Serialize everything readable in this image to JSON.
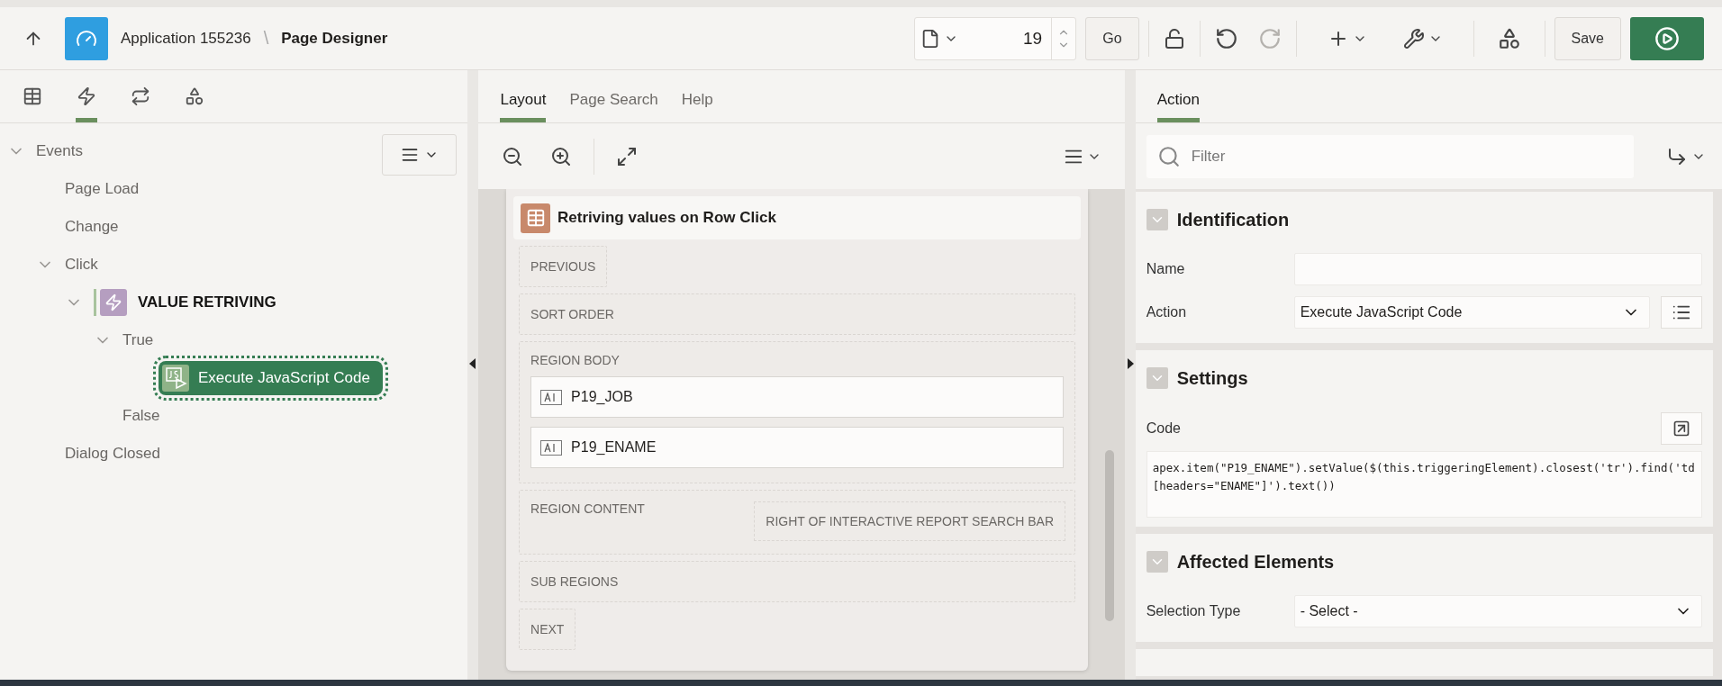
{
  "header": {
    "app": "Application 155236",
    "separator": "\\",
    "page": "Page Designer"
  },
  "toolbar": {
    "page_number": "19",
    "go_label": "Go",
    "save_label": "Save",
    "undo": {
      "disabled": false
    },
    "redo": {
      "disabled": true
    }
  },
  "left_tabs": [
    {
      "kind": "rendering",
      "selected": false
    },
    {
      "kind": "dynamic-actions",
      "selected": true
    },
    {
      "kind": "processing",
      "selected": false
    },
    {
      "kind": "shared",
      "selected": false
    }
  ],
  "tree": [
    {
      "label": "Events",
      "kind": "plain",
      "expanded": true,
      "selected": false,
      "children": [
        {
          "label": "Page Load",
          "kind": "plain",
          "selected": false
        },
        {
          "label": "Change",
          "kind": "plain",
          "selected": false
        },
        {
          "label": "Click",
          "kind": "plain",
          "expanded": true,
          "selected": false,
          "children": [
            {
              "label": "VALUE RETRIVING",
              "kind": "dynamic-action",
              "expanded": true,
              "selected": false,
              "children": [
                {
                  "label": "True",
                  "kind": "plain",
                  "expanded": true,
                  "selected": false,
                  "children": [
                    {
                      "label": "Execute JavaScript Code",
                      "kind": "action",
                      "selected": true
                    }
                  ]
                },
                {
                  "label": "False",
                  "kind": "plain",
                  "selected": false
                }
              ]
            }
          ]
        },
        {
          "label": "Dialog Closed",
          "kind": "plain",
          "selected": false
        }
      ]
    }
  ],
  "center_tabs": [
    {
      "label": "Layout",
      "selected": true
    },
    {
      "label": "Page Search",
      "selected": false
    },
    {
      "label": "Help",
      "selected": false
    }
  ],
  "region": {
    "title": "Retriving values on Row Click",
    "slots": [
      {
        "kind": "button",
        "label": "PREVIOUS"
      },
      {
        "kind": "wide",
        "label": "SORT ORDER"
      },
      {
        "kind": "body",
        "label": "REGION BODY",
        "items": [
          "P19_JOB",
          "P19_ENAME"
        ]
      },
      {
        "kind": "content",
        "label": "REGION CONTENT",
        "side": "RIGHT OF INTERACTIVE REPORT SEARCH BAR"
      },
      {
        "kind": "wide",
        "label": "SUB REGIONS"
      },
      {
        "kind": "button",
        "label": "NEXT"
      }
    ]
  },
  "right_tabs": [
    {
      "label": "Action",
      "selected": true
    }
  ],
  "filter": {
    "placeholder": "Filter"
  },
  "sections": [
    {
      "title": "Identification",
      "expanded": true,
      "fields": [
        {
          "kind": "text",
          "label": "Name"
        },
        {
          "kind": "select-list",
          "label": "Action",
          "value": "Execute JavaScript Code"
        }
      ]
    },
    {
      "title": "Settings",
      "expanded": true,
      "fields": [
        {
          "kind": "code",
          "label": "Code",
          "value": "apex.item(\"P19_ENAME\").setValue($(this.triggeringElement).closest('tr').find('td[headers=\"ENAME\"]').text())"
        }
      ]
    },
    {
      "title": "Affected Elements",
      "expanded": true,
      "fields": [
        {
          "kind": "select",
          "label": "Selection Type",
          "value": "- Select -"
        }
      ]
    }
  ]
}
